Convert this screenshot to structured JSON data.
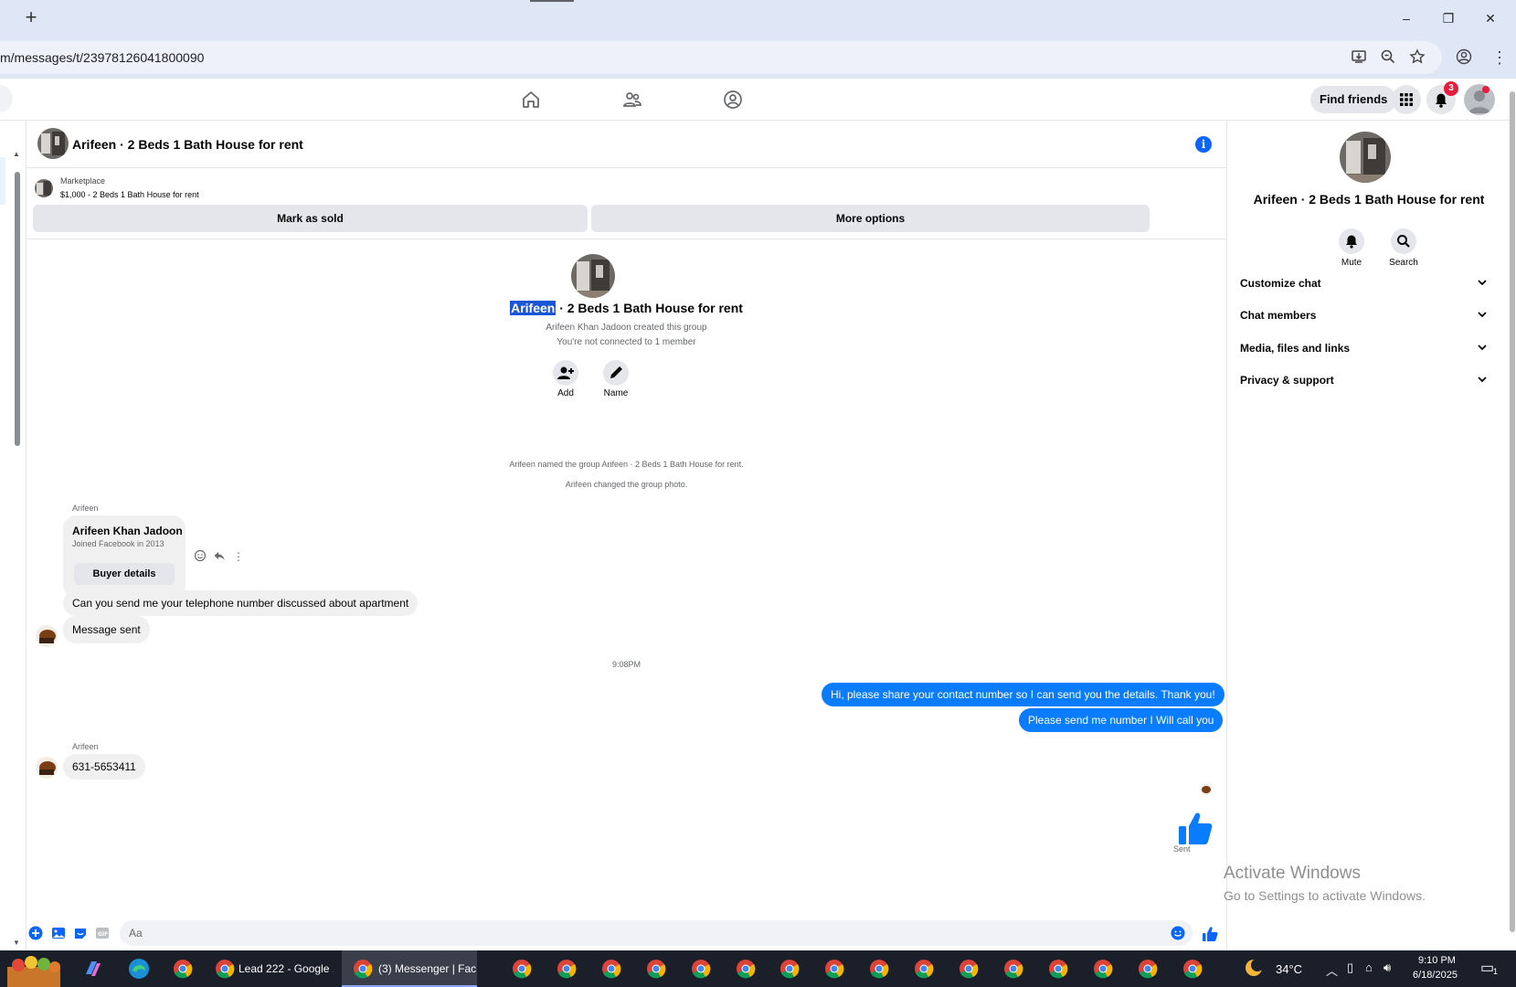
{
  "browser": {
    "url": "m/messages/t/23978126041800090",
    "new_tab": "+",
    "minimize": "–",
    "restore": "❐",
    "close": "✕"
  },
  "nav": {
    "find_friends": "Find friends",
    "notification_count": "3"
  },
  "chat": {
    "title": "Arifeen · 2 Beds 1 Bath House for rent",
    "marketplace_label": "Marketplace",
    "listing": "$1,000 - 2 Beds 1 Bath House for rent",
    "mark_sold": "Mark as sold",
    "more_options": "More options",
    "intro_highlight": "Arifeen",
    "intro_rest": " · 2 Beds 1 Bath House for rent",
    "created_by": "Arifeen Khan Jadoon created this group",
    "connection": "You're not connected to 1 member",
    "add_label": "Add",
    "name_label": "Name",
    "sys1": "Arifeen named the group Arifeen · 2 Beds 1 Bath House for rent.",
    "sys2": "Arifeen changed the group photo.",
    "sender1": "Arifeen",
    "card_name": "Arifeen Khan Jadoon",
    "card_sub": "Joined Facebook in 2013",
    "card_btn": "Buyer details",
    "msg_in_1": "Can you send me your telephone number discussed about apartment",
    "msg_in_2": "Message sent",
    "time": "9:08PM",
    "msg_out_1": "Hi, please share your contact number so I can send you the details. Thank you!",
    "msg_out_2": "Please send me number I Will call you",
    "sender2": "Arifeen",
    "msg_in_3": "631-5653411",
    "sent_label": "Sent",
    "composer_placeholder": "Aa"
  },
  "right_panel": {
    "title": "Arifeen · 2 Beds 1 Bath House for rent",
    "mute": "Mute",
    "search": "Search",
    "rows": [
      "Customize chat",
      "Chat members",
      "Media, files and links",
      "Privacy & support"
    ]
  },
  "watermark": {
    "line1": "Activate Windows",
    "line2": "Go to Settings to activate Windows."
  },
  "taskbar": {
    "app1": "Lead 222 - Google ...",
    "app2": "(3) Messenger | Fac...",
    "weather": "34°C",
    "time": "9:10 PM",
    "date": "6/18/2025",
    "notif": "1"
  },
  "colors": {
    "accent": "#0866ff",
    "outgoing_bubble": "#0a7cff",
    "incoming_bubble": "#f0f0f0",
    "badge": "#e41e3f"
  }
}
